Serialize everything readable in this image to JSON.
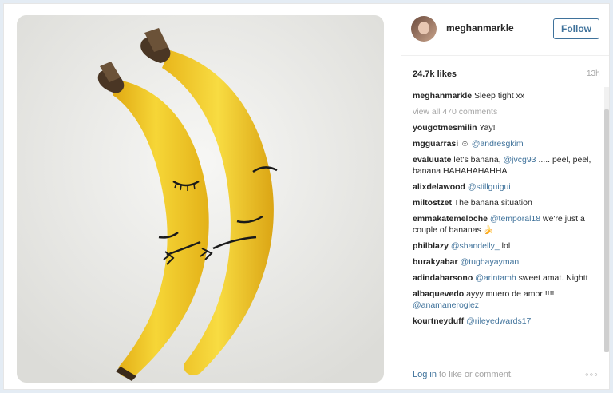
{
  "post": {
    "username": "meghanmarkle",
    "follow_label": "Follow",
    "likes": "24.7k likes",
    "time": "13h",
    "caption_user": "meghanmarkle",
    "caption_text": "Sleep tight xx",
    "view_all": "view all 470 comments"
  },
  "comments": [
    {
      "user": "yougotmesmilin",
      "pre": "Yay!",
      "mention": "",
      "post": ""
    },
    {
      "user": "mgguarrasi",
      "pre": "☺ ",
      "mention": "@andresgkim",
      "post": ""
    },
    {
      "user": "evaluuate",
      "pre": "let's banana, ",
      "mention": "@jvcg93",
      "post": " ..... peel, peel, banana HAHAHAHAHHA"
    },
    {
      "user": "alixdelawood",
      "pre": "",
      "mention": "@stillguigui",
      "post": ""
    },
    {
      "user": "miltostzet",
      "pre": "The banana situation",
      "mention": "",
      "post": ""
    },
    {
      "user": "emmakatemeloche",
      "pre": "",
      "mention": "@temporal18",
      "post": " we're just a couple of bananas 🍌"
    },
    {
      "user": "philblazy",
      "pre": "",
      "mention": "@shandelly_",
      "post": " lol"
    },
    {
      "user": "burakyabar",
      "pre": "",
      "mention": "@tugbayayman",
      "post": ""
    },
    {
      "user": "adindaharsono",
      "pre": "",
      "mention": "@arintamh",
      "post": " sweet amat. Nightt"
    },
    {
      "user": "albaquevedo",
      "pre": "ayyy muero de amor !!!! ",
      "mention": "@anamaneroglez",
      "post": ""
    },
    {
      "user": "kourtneyduff",
      "pre": "",
      "mention": "@rileyedwards17",
      "post": ""
    }
  ],
  "footer": {
    "login": "Log in",
    "rest": " to like or comment.",
    "more": "◦◦◦"
  },
  "colors": {
    "link": "#3f729b",
    "muted": "#a5a5a5",
    "banana": "#f2c925"
  },
  "icons": {
    "more": "more-options-icon"
  }
}
